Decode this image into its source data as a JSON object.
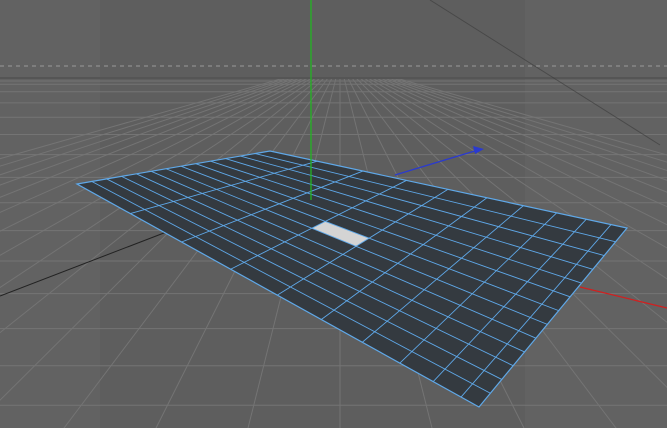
{
  "viewport": {
    "view": "perspective",
    "background_color": "#5e5e5e",
    "safe_frame_shade_color": "#6a6a6a",
    "grid_color": "#747474",
    "horizon_guide_color": "#9a9a9a",
    "polygon_face_color": "#343a40",
    "polygon_edge_color": "#5fa8e8",
    "selected_face_color": "#d4d4d4",
    "axis_colors": {
      "x": "#d02020",
      "y": "#22b422",
      "z": "#2a3ad0"
    },
    "plane": {
      "segments_width": 10,
      "segments_height": 13,
      "selected_polygon_count": 1
    }
  }
}
